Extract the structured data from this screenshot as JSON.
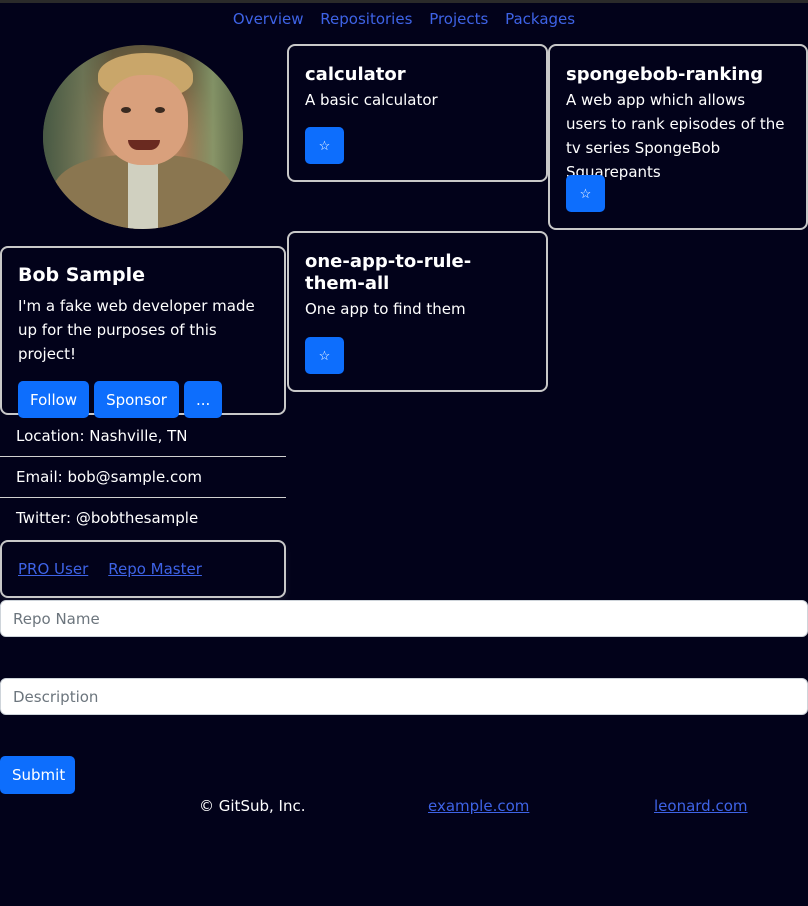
{
  "nav": {
    "items": [
      "Overview",
      "Repositories",
      "Projects",
      "Packages"
    ]
  },
  "profile": {
    "name": "Bob Sample",
    "bio": "I'm a fake web developer made up for the purposes of this project!",
    "follow_label": "Follow",
    "sponsor_label": "Sponsor",
    "more_label": "..."
  },
  "info": {
    "location": "Location: Nashville, TN",
    "email": "Email: bob@sample.com",
    "twitter": "Twitter: @bobthesample"
  },
  "badges": [
    "PRO User",
    "Repo Master"
  ],
  "repos": [
    {
      "name": "calculator",
      "description": "A basic calculator"
    },
    {
      "name": "spongebob-ranking",
      "description": "A web app which allows users to rank episodes of the tv series SpongeBob Squarepants"
    },
    {
      "name": "one-app-to-rule-them-all",
      "description": "One app to find them"
    }
  ],
  "star_icon": "☆",
  "form": {
    "repo_name_placeholder": "Repo Name",
    "description_placeholder": "Description",
    "submit_label": "Submit"
  },
  "footer": {
    "copyright": "© GitSub, Inc.",
    "link1": "example.com",
    "link2": "leonard.com"
  },
  "colors": {
    "background": "#02021a",
    "accent": "#0d6efd",
    "link": "#3e63e6"
  }
}
